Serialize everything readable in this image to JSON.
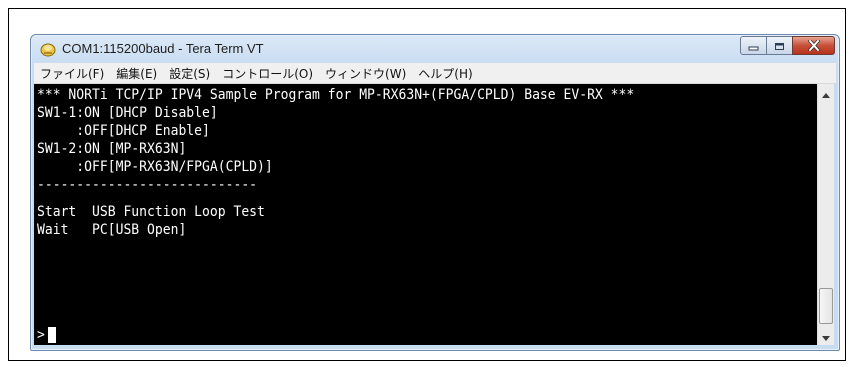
{
  "window": {
    "title": "COM1:115200baud - Tera Term VT"
  },
  "menu": {
    "items": [
      "ファイル(F)",
      "編集(E)",
      "設定(S)",
      "コントロール(O)",
      "ウィンドウ(W)",
      "ヘルプ(H)"
    ]
  },
  "terminal": {
    "lines": [
      "*** NORTi TCP/IP IPV4 Sample Program for MP-RX63N+(FPGA/CPLD) Base EV-RX ***",
      "SW1-1:ON [DHCP Disable]",
      "     :OFF[DHCP Enable]",
      "SW1-2:ON [MP-RX63N]",
      "     :OFF[MP-RX63N/FPGA(CPLD)]",
      "----------------------------",
      "Start  USB Function Loop Test",
      "Wait   PC[USB Open]",
      "",
      ">"
    ],
    "background": "#000000",
    "foreground": "#ffffff"
  },
  "icons": {
    "app": "teraterm-app-icon",
    "minimize": "minimize-icon",
    "maximize": "maximize-icon",
    "close": "close-icon",
    "scroll_up": "scroll-up-arrow-icon",
    "scroll_down": "scroll-down-arrow-icon"
  },
  "colors": {
    "close_button": "#c7503a",
    "titlebar": "#dce9f7"
  }
}
